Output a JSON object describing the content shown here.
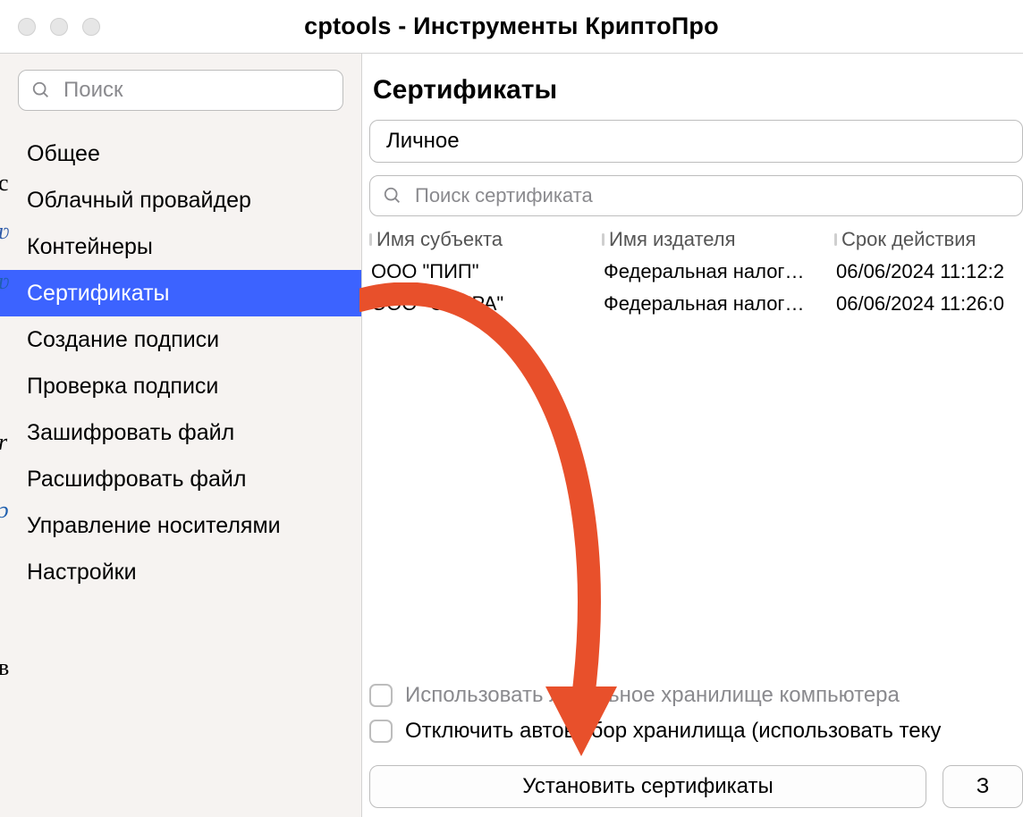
{
  "window": {
    "title": "cptools - Инструменты КриптоПро"
  },
  "sidebar": {
    "search_placeholder": "Поиск",
    "selected_index": 3,
    "items": [
      {
        "label": "Общее"
      },
      {
        "label": "Облачный провайдер"
      },
      {
        "label": "Контейнеры"
      },
      {
        "label": "Сертификаты"
      },
      {
        "label": "Создание подписи"
      },
      {
        "label": "Проверка подписи"
      },
      {
        "label": "Зашифровать файл"
      },
      {
        "label": "Расшифровать файл"
      },
      {
        "label": "Управление носителями"
      },
      {
        "label": "Настройки"
      }
    ]
  },
  "main": {
    "title": "Сертификаты",
    "store_selected": "Личное",
    "cert_search_placeholder": "Поиск сертификата",
    "columns": {
      "subject": "Имя субъекта",
      "issuer": "Имя издателя",
      "expires": "Срок действия"
    },
    "rows": [
      {
        "subject": "ООО \"ПИП\"",
        "issuer": "Федеральная налог…",
        "expires": "06/06/2024 11:12:2"
      },
      {
        "subject": "ООО \"СФЕРА\"",
        "issuer": "Федеральная налог…",
        "expires": "06/06/2024 11:26:0"
      }
    ],
    "options": {
      "use_local_store": "Использовать локальное хранилище компьютера",
      "disable_autoselect": "Отключить автовыбор хранилища (использовать теку"
    },
    "buttons": {
      "install": "Установить сертификаты",
      "secondary": "З"
    }
  },
  "annotation": {
    "arrow_color": "#E8502B"
  }
}
